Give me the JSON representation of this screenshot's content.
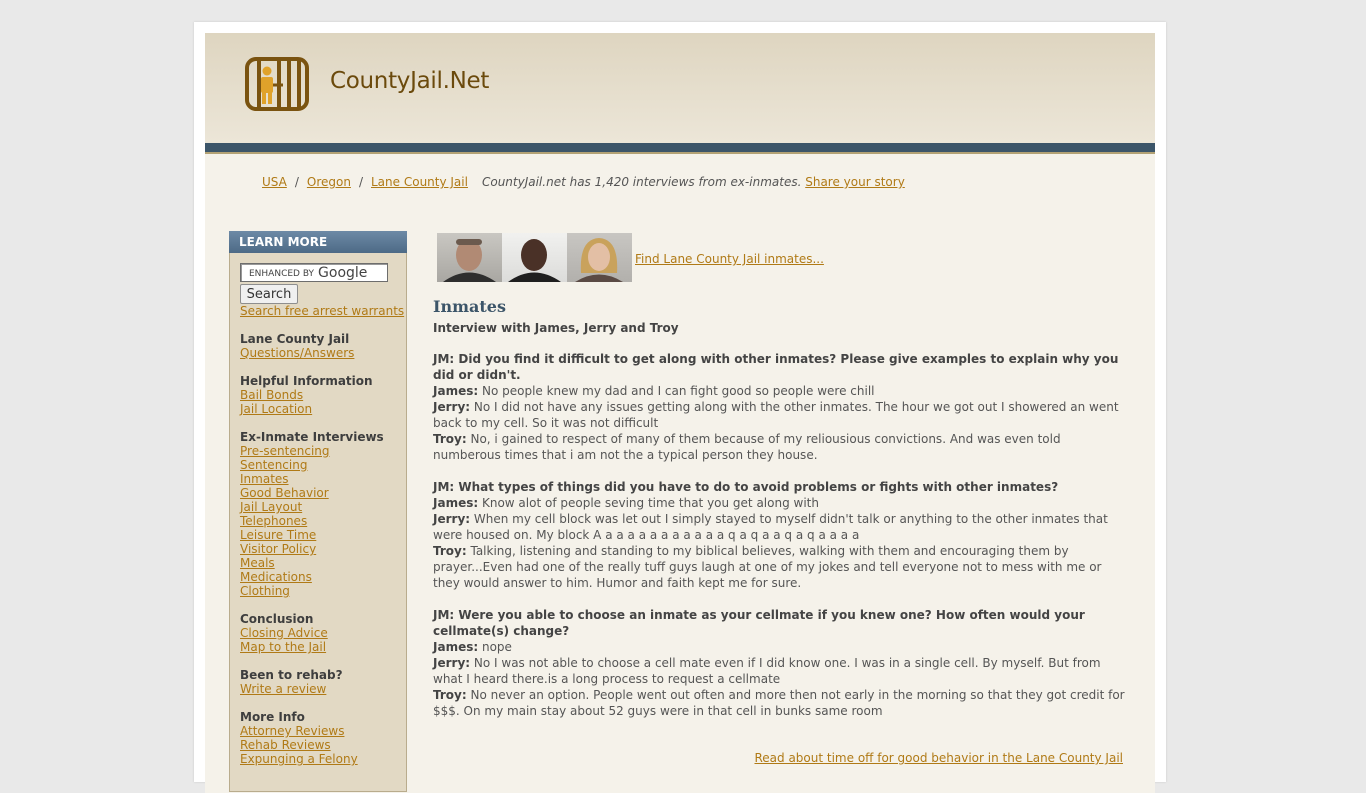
{
  "site": {
    "name": "CountyJail.Net"
  },
  "breadcrumb": {
    "items": [
      "USA",
      "Oregon",
      "Lane County Jail"
    ],
    "note": "CountyJail.net has 1,420 interviews from ex-inmates.",
    "share": "Share your story"
  },
  "sidebar": {
    "header": "LEARN MORE",
    "search_placeholder": "ENHANCED BY",
    "search_brand": "Google",
    "search_button": "Search",
    "arrest_link": "Search free arrest warrants",
    "sections": [
      {
        "title": "Lane County Jail",
        "links": [
          "Questions/Answers"
        ]
      },
      {
        "title": "Helpful Information",
        "links": [
          "Bail Bonds",
          "Jail Location"
        ]
      },
      {
        "title": "Ex-Inmate Interviews",
        "links": [
          "Pre-sentencing",
          "Sentencing",
          "Inmates",
          "Good Behavior",
          "Jail Layout",
          "Telephones",
          "Leisure Time",
          "Visitor Policy",
          "Meals",
          "Medications",
          "Clothing"
        ]
      },
      {
        "title": "Conclusion",
        "links": [
          "Closing Advice",
          "Map to the Jail"
        ]
      },
      {
        "title": "Been to rehab?",
        "links": [
          "Write a review"
        ]
      },
      {
        "title": "More Info",
        "links": [
          "Attorney Reviews",
          "Rehab Reviews",
          "Expunging a Felony"
        ]
      }
    ]
  },
  "main": {
    "find_link": "Find Lane County Jail inmates...",
    "title": "Inmates",
    "subtitle": "Interview with James, Jerry and Troy",
    "qa": [
      {
        "q": "JM: Did you find it difficult to get along with other inmates? Please give examples to explain why you did or didn't.",
        "answers": [
          {
            "who": "James:",
            "text": "No people knew my dad and I can fight good so people were chill"
          },
          {
            "who": "Jerry:",
            "text": "No I did not have any issues getting along with the other inmates. The hour we got out I showered an went back to my cell. So it was not difficult"
          },
          {
            "who": "Troy:",
            "text": "No, i gained to respect of many of them because of my reliousious convictions. And was even told numberous times that i am not the a typical person they house."
          }
        ]
      },
      {
        "q": "JM: What types of things did you have to do to avoid problems or fights with other inmates?",
        "answers": [
          {
            "who": "James:",
            "text": "Know alot of people seving time that you get along with"
          },
          {
            "who": "Jerry:",
            "text": "When my cell block was let out I simply stayed to myself didn't talk or anything to the other inmates that were housed on. My block A a a a a a a a a a a a q a q a a q a q a a a a"
          },
          {
            "who": "Troy:",
            "text": "Talking, listening and standing to my biblical believes, walking with them and encouraging them by prayer...Even had one of the really tuff guys laugh at one of my jokes and tell everyone not to mess with me or they would answer to him. Humor and faith kept me for sure."
          }
        ]
      },
      {
        "q": "JM: Were you able to choose an inmate as your cellmate if you knew one? How often would your cellmate(s) change?",
        "answers": [
          {
            "who": "James:",
            "text": "nope"
          },
          {
            "who": "Jerry:",
            "text": "No I was not able to choose a cell mate even if I did know one. I was in a single cell. By myself. But from what I heard there.is a long process to request a cellmate"
          },
          {
            "who": "Troy:",
            "text": "No never an option. People went out often and more then not early in the morning so that they got credit for $$$. On my main stay about 52 guys were in that cell in bunks same room"
          }
        ]
      }
    ],
    "bottom_link": "Read about time off for good behavior in the Lane County Jail"
  }
}
